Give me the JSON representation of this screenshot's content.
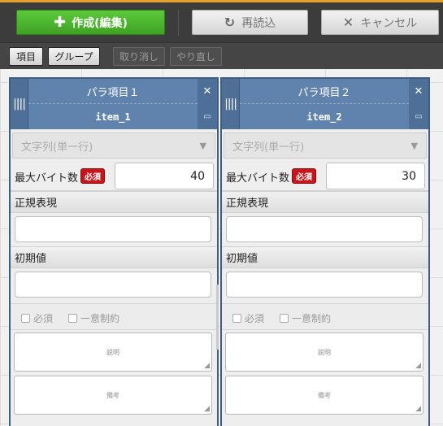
{
  "toolbar": {
    "create_label": "作成(編集)",
    "reload_label": "再読込",
    "cancel_label": "キャンセル"
  },
  "subtoolbar": {
    "item_label": "項目",
    "group_label": "グループ",
    "undo_label": "取り消し",
    "redo_label": "やり直し"
  },
  "panels": [
    {
      "title": "パラ項目１",
      "name": "item_1",
      "type_value": "文字列(単一行)",
      "max_bytes_label": "最大バイト数",
      "required_badge": "必須",
      "max_bytes_value": "40",
      "regex_label": "正規表現",
      "default_label": "初期値",
      "required_check": "必須",
      "unique_check": "一意制約",
      "description_placeholder": "説明",
      "note_placeholder": "備考"
    },
    {
      "title": "パラ項目２",
      "name": "item_2",
      "type_value": "文字列(単一行)",
      "max_bytes_label": "最大バイト数",
      "required_badge": "必須",
      "max_bytes_value": "30",
      "regex_label": "正規表現",
      "default_label": "初期値",
      "required_check": "必須",
      "unique_check": "一意制約",
      "description_placeholder": "説明",
      "note_placeholder": "備考"
    }
  ],
  "icons": {
    "create": "plus-icon",
    "reload": "refresh-icon",
    "cancel": "x-icon",
    "drag": "drag-handle-icon",
    "close": "close-icon",
    "resize": "resize-icon",
    "dropdown": "chevron-down-icon"
  },
  "colors": {
    "create_button": "#4cb82e",
    "panel_header": "#6083ad",
    "required_badge": "#c8151b",
    "accent_bar": "#e8a12a"
  }
}
